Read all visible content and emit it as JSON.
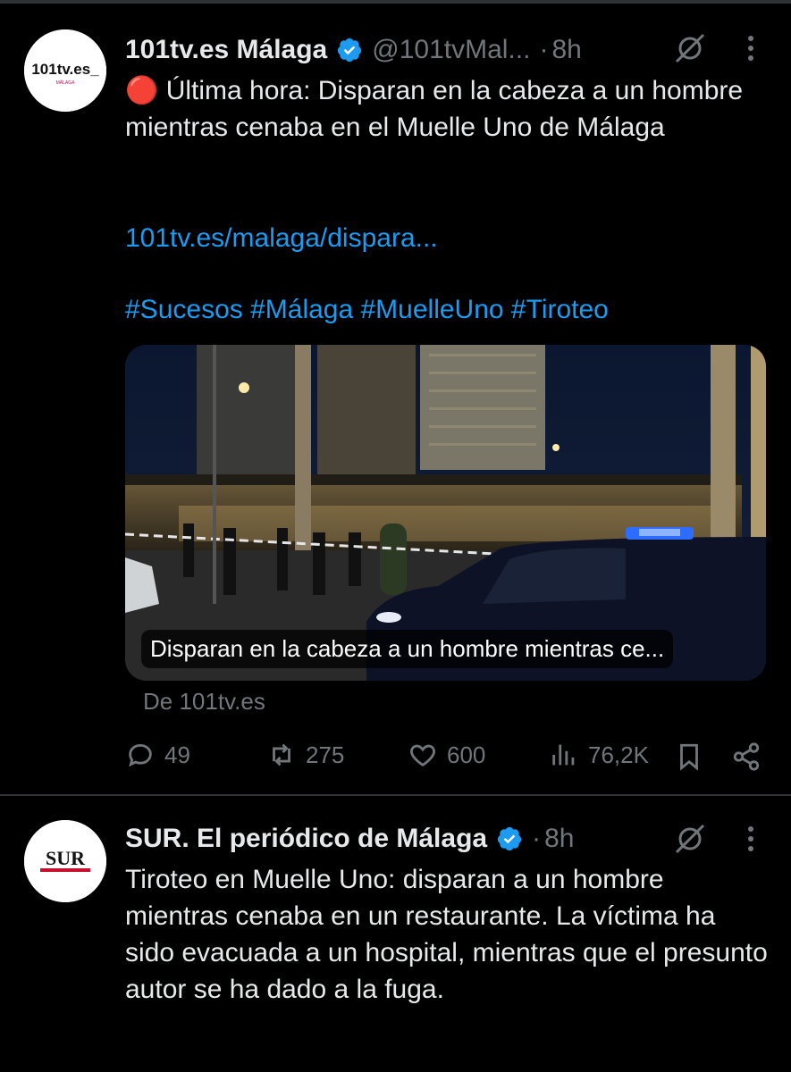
{
  "tweet1": {
    "avatar_text": "101tv.es_",
    "avatar_sub": "MÁLAGA",
    "name": "101tv.es Málaga",
    "handle": "@101tvMal...",
    "dot": "·",
    "time": "8h",
    "emoji": "🔴",
    "text": "Última hora: Disparan en la cabeza a un hombre mientras cenaba en el Muelle Uno de Málaga",
    "link": "101tv.es/malaga/dispara...",
    "hashtags": "#Sucesos #Málaga #MuelleUno #Tiroteo",
    "card_caption": "Disparan en la cabeza a un hombre mientras ce...",
    "card_source": "De 101tv.es",
    "replies": "49",
    "reposts": "275",
    "likes": "600",
    "views": "76,2K"
  },
  "tweet2": {
    "avatar_text": "SUR",
    "name": "SUR. El periódico de Málaga",
    "dot": "·",
    "time": "8h",
    "text": "Tiroteo en Muelle Uno: disparan a un hombre mientras cenaba en un restaurante. La víctima ha sido evacuada a un hospital, mientras que el presunto autor se ha dado a la fuga."
  },
  "colors": {
    "background": "#000000",
    "text": "#e7e9ea",
    "muted": "#71767b",
    "link": "#1d9bf0",
    "verified": "#1d9bf0"
  },
  "icons": [
    "verified-badge-icon",
    "grok-icon",
    "more-icon",
    "reply-icon",
    "repost-icon",
    "like-icon",
    "views-icon",
    "bookmark-icon",
    "share-icon"
  ]
}
